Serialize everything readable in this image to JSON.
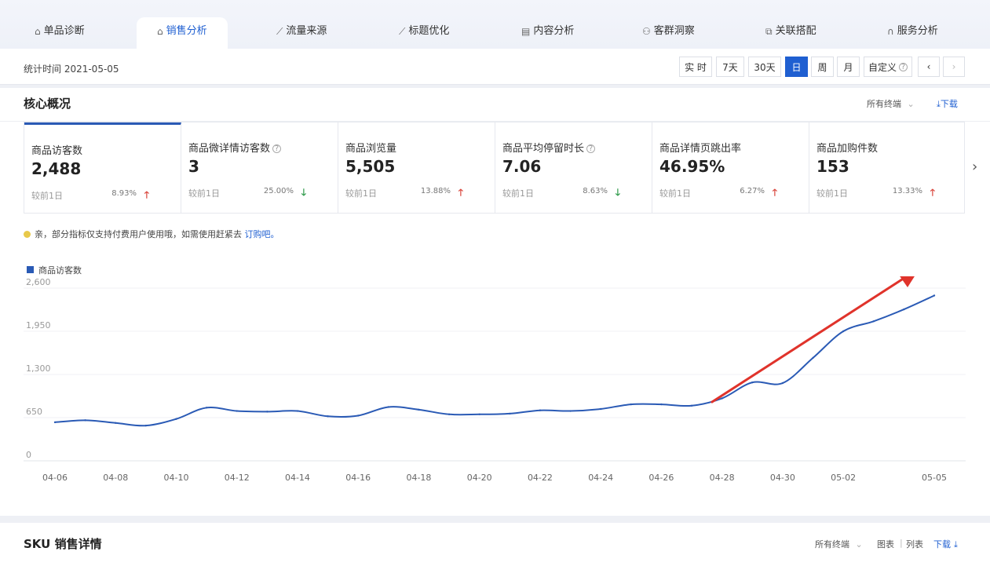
{
  "nav": {
    "tabs": [
      {
        "label": "单品诊断",
        "icon": "bag-icon"
      },
      {
        "label": "销售分析",
        "icon": "bag-icon",
        "active": true
      },
      {
        "label": "流量来源",
        "icon": "line-chart-icon"
      },
      {
        "label": "标题优化",
        "icon": "line-chart-icon"
      },
      {
        "label": "内容分析",
        "icon": "document-icon"
      },
      {
        "label": "客群洞察",
        "icon": "users-icon"
      },
      {
        "label": "关联搭配",
        "icon": "link-icon"
      },
      {
        "label": "服务分析",
        "icon": "headset-icon"
      }
    ]
  },
  "toolbar": {
    "stat_time": "统计时间 2021-05-05",
    "ranges": [
      "实 时",
      "7天",
      "30天",
      "日",
      "周",
      "月",
      "自定义"
    ],
    "active_range": "日",
    "prev": "‹",
    "next": "›"
  },
  "overview": {
    "title": "核心概况",
    "terminal": "所有终端",
    "download": "下载",
    "compare_label": "较前1日",
    "metrics": [
      {
        "name": "商品访客数",
        "value": "2,488",
        "change": "8.93%",
        "trend": "up",
        "help": false
      },
      {
        "name": "商品微详情访客数",
        "value": "3",
        "change": "25.00%",
        "trend": "down",
        "help": true
      },
      {
        "name": "商品浏览量",
        "value": "5,505",
        "change": "13.88%",
        "trend": "up",
        "help": false
      },
      {
        "name": "商品平均停留时长",
        "value": "7.06",
        "change": "8.63%",
        "trend": "down",
        "help": true
      },
      {
        "name": "商品详情页跳出率",
        "value": "46.95%",
        "change": "6.27%",
        "trend": "up",
        "help": false
      },
      {
        "name": "商品加购件数",
        "value": "153",
        "change": "13.33%",
        "trend": "up",
        "help": false
      }
    ],
    "notice_text": "亲，部分指标仅支持付费用户使用哦，如需使用赶紧去",
    "notice_link": "订购吧。"
  },
  "chart_data": {
    "type": "line",
    "legend": "商品访客数",
    "series_color": "#2a5ab5",
    "ylim": [
      0,
      2600
    ],
    "yticks": [
      "2,600",
      "1,950",
      "1,300",
      "650",
      "0"
    ],
    "xtick_labels": [
      "04-06",
      "04-08",
      "04-10",
      "04-12",
      "04-14",
      "04-16",
      "04-18",
      "04-20",
      "04-22",
      "04-24",
      "04-26",
      "04-28",
      "04-30",
      "05-02",
      "05-05"
    ],
    "x": [
      "04-06",
      "04-07",
      "04-08",
      "04-09",
      "04-10",
      "04-11",
      "04-12",
      "04-13",
      "04-14",
      "04-15",
      "04-16",
      "04-17",
      "04-18",
      "04-19",
      "04-20",
      "04-21",
      "04-22",
      "04-23",
      "04-24",
      "04-25",
      "04-26",
      "04-27",
      "04-28",
      "04-29",
      "04-30",
      "05-01",
      "05-02",
      "05-03",
      "05-04",
      "05-05"
    ],
    "values": [
      580,
      610,
      570,
      530,
      630,
      800,
      750,
      740,
      750,
      670,
      680,
      810,
      770,
      700,
      700,
      710,
      760,
      750,
      780,
      850,
      850,
      830,
      940,
      1180,
      1170,
      1550,
      1950,
      2100,
      2280,
      2488
    ],
    "annotation": "red-arrow"
  },
  "sku": {
    "title": "SKU 销售详情",
    "terminal": "所有终端",
    "chart_view": "图表",
    "list_view": "列表",
    "download": "下载"
  }
}
